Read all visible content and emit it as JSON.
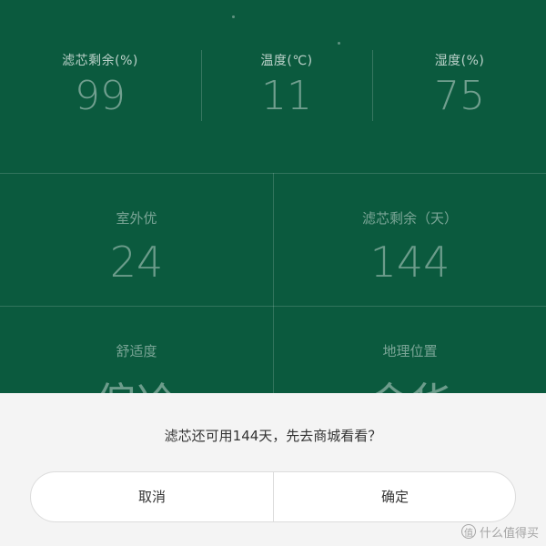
{
  "top_stats": [
    {
      "label": "滤芯剩余(%)",
      "value": "99"
    },
    {
      "label": "温度(℃)",
      "value": "11"
    },
    {
      "label": "湿度(%)",
      "value": "75"
    }
  ],
  "grid": [
    {
      "label": "室外优",
      "value": "24"
    },
    {
      "label": "滤芯剩余（天）",
      "value": "144"
    },
    {
      "label": "舒适度",
      "value": "偏冷"
    },
    {
      "label": "地理位置",
      "value": "金华"
    }
  ],
  "dialog": {
    "message": "滤芯还可用144天，先去商城看看？",
    "cancel_label": "取消",
    "confirm_label": "确定"
  },
  "watermark": {
    "icon": "值",
    "text": "什么值得买"
  },
  "colors": {
    "background": "#0b5a3e",
    "sheet": "#f4f4f4"
  }
}
